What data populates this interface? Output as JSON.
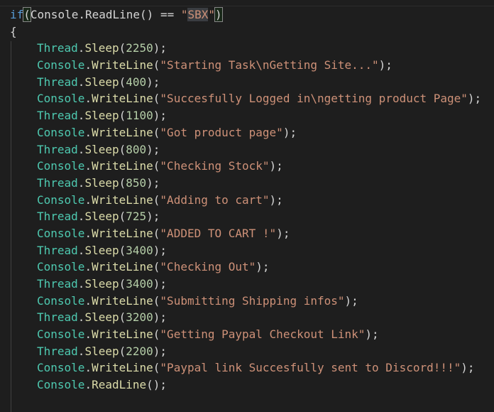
{
  "code": {
    "if_keyword": "if",
    "if_open_paren": "(",
    "if_class": "Console",
    "if_method": "ReadLine",
    "if_call_parens": "()",
    "if_operator": " == ",
    "if_quote_open": "\"",
    "if_string": "SBX",
    "if_quote_close": "\"",
    "if_close_paren": ")",
    "open_brace": "{",
    "dot": ".",
    "open": "(",
    "close": ");",
    "statements": [
      {
        "cls": "Thread",
        "method": "Sleep",
        "arg": "2250",
        "kind": "num"
      },
      {
        "cls": "Console",
        "method": "WriteLine",
        "arg": "\"Starting Task\\nGetting Site...\"",
        "kind": "str"
      },
      {
        "cls": "Thread",
        "method": "Sleep",
        "arg": "400",
        "kind": "num"
      },
      {
        "cls": "Console",
        "method": "WriteLine",
        "arg": "\"Succesfully Logged in\\ngetting product Page\"",
        "kind": "str"
      },
      {
        "cls": "Thread",
        "method": "Sleep",
        "arg": "1100",
        "kind": "num"
      },
      {
        "cls": "Console",
        "method": "WriteLine",
        "arg": "\"Got product page\"",
        "kind": "str"
      },
      {
        "cls": "Thread",
        "method": "Sleep",
        "arg": "800",
        "kind": "num"
      },
      {
        "cls": "Console",
        "method": "WriteLine",
        "arg": "\"Checking Stock\"",
        "kind": "str"
      },
      {
        "cls": "Thread",
        "method": "Sleep",
        "arg": "850",
        "kind": "num"
      },
      {
        "cls": "Console",
        "method": "WriteLine",
        "arg": "\"Adding to cart\"",
        "kind": "str"
      },
      {
        "cls": "Thread",
        "method": "Sleep",
        "arg": "725",
        "kind": "num"
      },
      {
        "cls": "Console",
        "method": "WriteLine",
        "arg": "\"ADDED TO CART !\"",
        "kind": "str"
      },
      {
        "cls": "Thread",
        "method": "Sleep",
        "arg": "3400",
        "kind": "num"
      },
      {
        "cls": "Console",
        "method": "WriteLine",
        "arg": "\"Checking Out\"",
        "kind": "str"
      },
      {
        "cls": "Thread",
        "method": "Sleep",
        "arg": "3400",
        "kind": "num"
      },
      {
        "cls": "Console",
        "method": "WriteLine",
        "arg": "\"Submitting Shipping infos\"",
        "kind": "str"
      },
      {
        "cls": "Thread",
        "method": "Sleep",
        "arg": "3200",
        "kind": "num"
      },
      {
        "cls": "Console",
        "method": "WriteLine",
        "arg": "\"Getting Paypal Checkout Link\"",
        "kind": "str"
      },
      {
        "cls": "Thread",
        "method": "Sleep",
        "arg": "2200",
        "kind": "num"
      },
      {
        "cls": "Console",
        "method": "WriteLine",
        "arg": "\"Paypal link Succesfully sent to Discord!!!\"",
        "kind": "str"
      },
      {
        "cls": "Console",
        "method": "ReadLine",
        "arg": "",
        "kind": "none"
      }
    ]
  },
  "colors": {
    "background": "#1e1e1e",
    "keyword": "#569cd6",
    "class": "#4ec9b0",
    "method": "#dcdcaa",
    "number": "#b5cea8",
    "string": "#ce9178",
    "plain": "#d4d4d4"
  }
}
